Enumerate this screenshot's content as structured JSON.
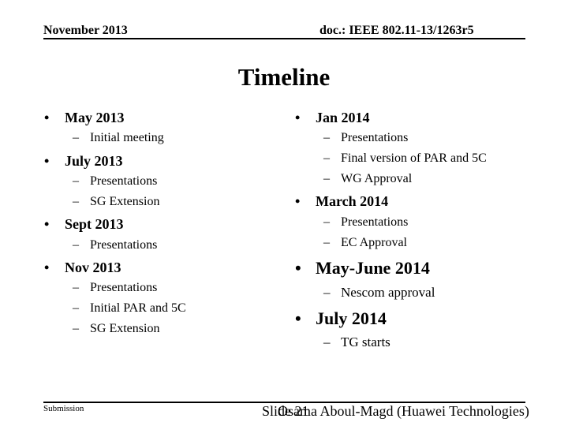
{
  "header": {
    "date": "November 2013",
    "doc": "doc.: IEEE 802.11-13/1263r5"
  },
  "title": "Timeline",
  "bullet_glyph": "•",
  "dash_glyph": "–",
  "left_column": [
    {
      "label": "May 2013",
      "subs": [
        "Initial meeting"
      ]
    },
    {
      "label": "July 2013",
      "subs": [
        "Presentations",
        "SG Extension"
      ]
    },
    {
      "label": "Sept 2013",
      "subs": [
        "Presentations"
      ]
    },
    {
      "label": "Nov 2013",
      "subs": [
        "Presentations",
        "Initial PAR and 5C",
        "SG Extension"
      ]
    }
  ],
  "right_column": [
    {
      "label": "Jan 2014",
      "subs": [
        "Presentations",
        "Final version of PAR and 5C",
        "WG Approval"
      ]
    },
    {
      "label": "March 2014",
      "subs": [
        "Presentations",
        "EC Approval"
      ]
    },
    {
      "label": "May-June 2014",
      "subs": [
        "Nescom approval"
      ]
    },
    {
      "label": "July 2014",
      "subs": [
        "TG starts"
      ]
    }
  ],
  "footer": {
    "left": "Submission",
    "slide": "Slide 21",
    "author": "Osama Aboul-Magd (Huawei Technologies)"
  }
}
